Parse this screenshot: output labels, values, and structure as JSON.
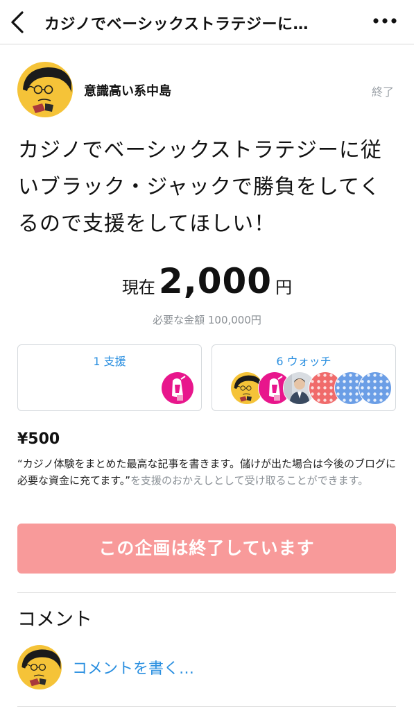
{
  "header": {
    "title": "カジノでベーシックストラテジーに…",
    "back_icon": "chevron-left-icon",
    "more_icon": "more-horizontal-icon"
  },
  "project": {
    "author_name": "意識高い系中島",
    "status": "終了",
    "title": "カジノでベーシックストラテジーに従いブラック・ジャックで勝負をしてくるので支援をしてほしい！",
    "amount_prefix": "現在",
    "amount_value": "2,000",
    "amount_unit": "円",
    "goal_text": "必要な金額 100,000円"
  },
  "stats": {
    "supports_label": "1 支援",
    "watch_label": "6 ウォッチ"
  },
  "reward": {
    "price": "¥500",
    "description": "“カジノ体験をまとめた最高な記事を書きます。儲けが出た場合は今後のブログに必要な資金に充てます。”",
    "description_suffix": "を支援のおかえしとして受け取ることができます。"
  },
  "cta": {
    "closed_label": "この企画は終了しています"
  },
  "comments": {
    "heading": "コメント",
    "write_placeholder": "コメントを書く…"
  },
  "colors": {
    "accent_blue": "#2a8fe0",
    "closed_button": "#f89a9a",
    "avatar_yellow": "#f5c338",
    "avatar_magenta": "#e8168c",
    "polka_red": "#f06b6b",
    "polka_blue": "#6b9ee6"
  }
}
